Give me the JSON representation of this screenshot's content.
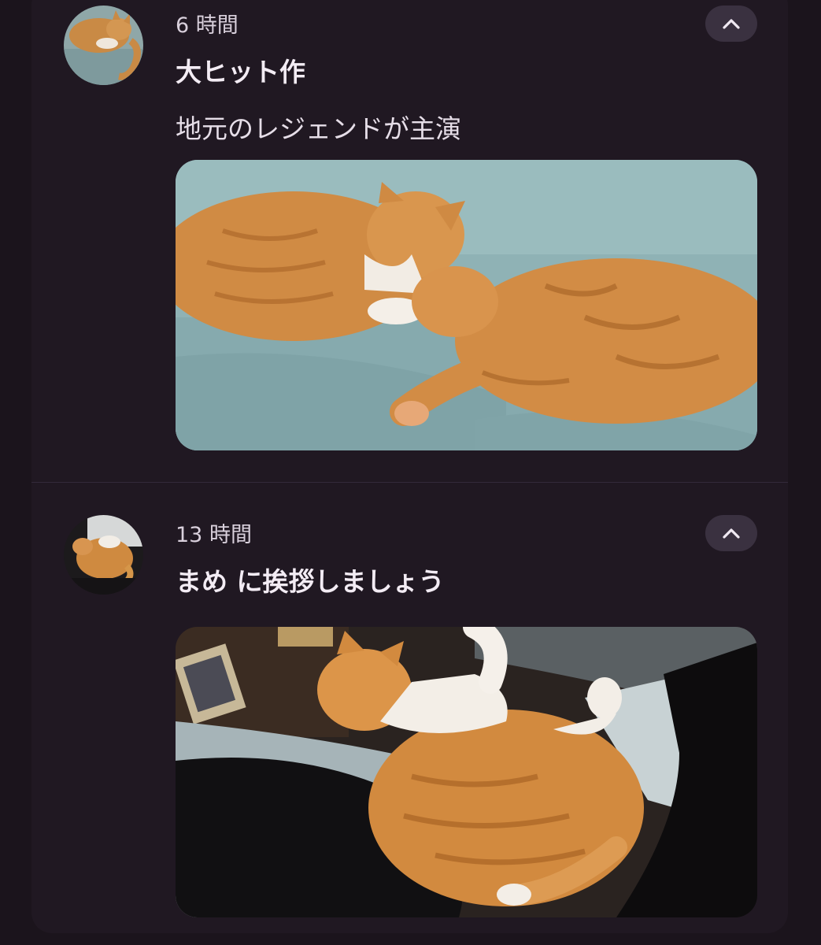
{
  "feed": {
    "posts": [
      {
        "time": "6 時間",
        "title": "大ヒット作",
        "body": "地元のレジェンドが主演",
        "collapse_icon": "chevron-up-icon",
        "avatar": "cat-avatar",
        "photo": "two-cats-on-sofa-photo"
      },
      {
        "time": "13 時間",
        "title": "まめ に挨拶しましょう",
        "collapse_icon": "chevron-up-icon",
        "avatar": "cat-avatar",
        "photo": "cat-on-lap-photo"
      }
    ]
  },
  "colors": {
    "background": "#1b141c",
    "panel": "#201822",
    "button": "#3a3140",
    "text": "#ece4ee"
  }
}
